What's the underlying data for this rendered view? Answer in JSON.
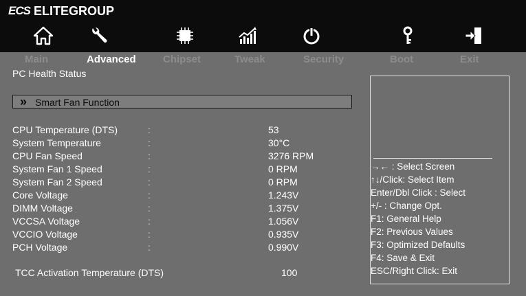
{
  "brand": {
    "logo": "ECS",
    "name": "ELITEGROUP"
  },
  "icons": [
    {
      "name": "home-icon"
    },
    {
      "name": "wrench-icon"
    },
    {
      "name": "chip-icon"
    },
    {
      "name": "chart-icon"
    },
    {
      "name": "power-icon"
    },
    {
      "name": "key-icon"
    },
    {
      "name": "exit-icon"
    }
  ],
  "menu": {
    "items": [
      "Main",
      "Advanced",
      "Chipset",
      "Tweak",
      "Security",
      "Boot",
      "Exit"
    ],
    "selected": "Advanced"
  },
  "page": {
    "title": "PC Health Status",
    "submenu": {
      "arrow": "»",
      "label": "Smart Fan Function"
    }
  },
  "readings": [
    {
      "label": "CPU Temperature (DTS)",
      "colon": ":",
      "value": "53"
    },
    {
      "label": "System Temperature",
      "colon": ":",
      "value": "30°C"
    },
    {
      "label": "CPU Fan Speed",
      "colon": ":",
      "value": "3276 RPM"
    },
    {
      "label": "System Fan 1 Speed",
      "colon": ":",
      "value": "0 RPM"
    },
    {
      "label": "System Fan 2 Speed",
      "colon": ":",
      "value": "0 RPM"
    },
    {
      "label": "Core Voltage",
      "colon": ":",
      "value": "1.243V"
    },
    {
      "label": "DIMM Voltage",
      "colon": ":",
      "value": "1.375V"
    },
    {
      "label": "VCCSA Voltage",
      "colon": ":",
      "value": "1.056V"
    },
    {
      "label": "VCCIO Voltage",
      "colon": ":",
      "value": "0.935V"
    },
    {
      "label": "PCH Voltage",
      "colon": ":",
      "value": "0.990V"
    }
  ],
  "tcc": {
    "label": "TCC Activation Temperature (DTS)",
    "value": "100"
  },
  "help": [
    "→← : Select Screen",
    "↑↓/Click: Select Item",
    "Enter/Dbl Click : Select",
    "+/- : Change Opt.",
    "F1: General Help",
    "F2: Previous Values",
    "F3: Optimized Defaults",
    "F4: Save & Exit",
    "ESC/Right Click: Exit"
  ],
  "colors": {
    "header_bg": "#0c0c0c",
    "body_bg": "#6e6e6e",
    "menu_inactive": "#8c8c8c",
    "menu_active": "#ffffff",
    "submenu_bg": "#7d7d7d"
  }
}
